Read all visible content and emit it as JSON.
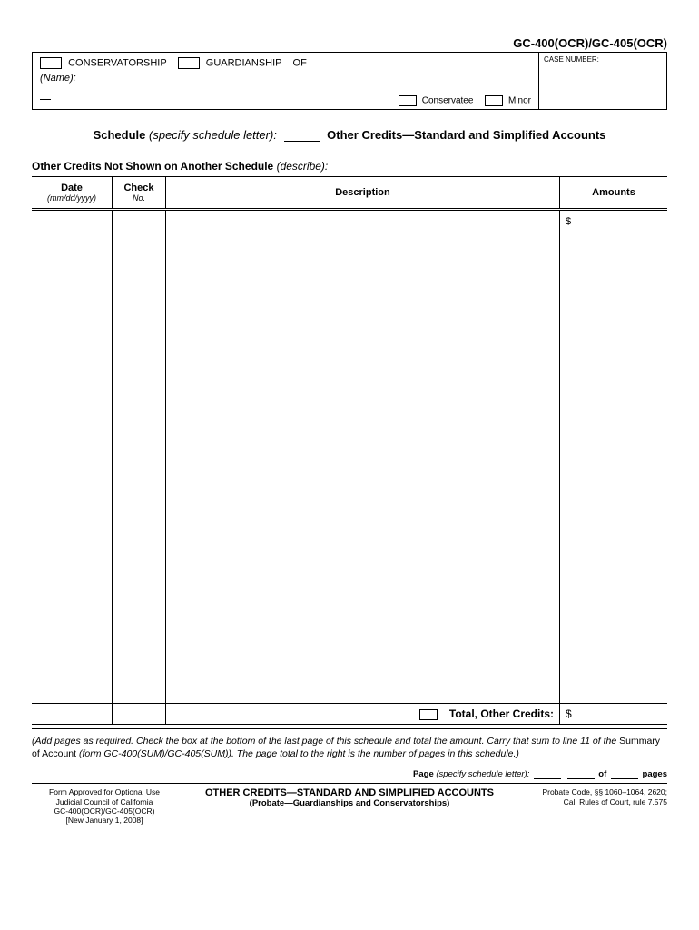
{
  "form_code": "GC-400(OCR)/GC-405(OCR)",
  "header": {
    "conservatorship_label": "CONSERVATORSHIP",
    "guardianship_label": "GUARDIANSHIP",
    "of_label": "OF",
    "name_label": "(Name):",
    "conservatee_label": "Conservatee",
    "minor_label": "Minor",
    "case_number_label": "CASE NUMBER:"
  },
  "schedule_line": {
    "schedule_bold": "Schedule",
    "specify": "(specify schedule letter):",
    "title_rest": "Other Credits—Standard and Simplified Accounts"
  },
  "section": {
    "title": "Other Credits Not Shown on Another Schedule",
    "describe": "(describe):"
  },
  "table": {
    "date_header": "Date",
    "date_sub": "(mm/dd/yyyy)",
    "check_header": "Check",
    "check_sub": "No.",
    "desc_header": "Description",
    "amt_header": "Amounts",
    "dollar": "$",
    "total_label": "Total, Other Credits:"
  },
  "instructions": {
    "text_part1": "(Add pages as required.  Check the box at the bottom of the last page of this schedule  and total the amount. Carry that sum to line 11 of the ",
    "nonitalic": "Summary of Account",
    "text_part2": " (form GC-400(SUM)/GC-405(SUM)). The page total to the right is the number of pages in this schedule.)"
  },
  "page_line": {
    "page": "Page",
    "specify": "(specify schedule letter):",
    "of": "of",
    "pages": "pages"
  },
  "footer": {
    "left_line1": "Form Approved for Optional Use",
    "left_line2": "Judicial Council of California",
    "left_line3": "GC-400(OCR)/GC-405(OCR)",
    "left_line4": "[New January 1, 2008]",
    "center_title": "OTHER CREDITS—STANDARD AND SIMPLIFIED ACCOUNTS",
    "center_sub": "(Probate—Guardianships and Conservatorships)",
    "right_line1": "Probate Code, §§ 1060–1064, 2620;",
    "right_line2": "Cal. Rules  of Court, rule 7.575"
  }
}
